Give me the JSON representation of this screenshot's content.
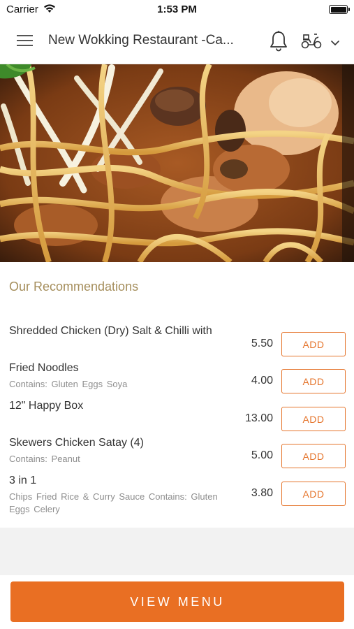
{
  "status_bar": {
    "carrier": "Carrier",
    "time": "1:53 PM"
  },
  "header": {
    "title": "New Wokking Restaurant -Ca...",
    "icons": [
      "menu-icon",
      "bell-icon",
      "scooter-icon",
      "chevron-down-icon"
    ]
  },
  "hero": {
    "image_description_icon": "food-photo"
  },
  "recommendations": {
    "title": "Our Recommendations",
    "items": [
      {
        "name": "Shredded Chicken (Dry) Salt & Chilli with",
        "sub": "",
        "price": "5.50",
        "button": "ADD"
      },
      {
        "name": "Fried Noodles",
        "sub": "Contains:  Gluten  Eggs  Soya",
        "price": "4.00",
        "button": "ADD"
      },
      {
        "name": "12\" Happy Box",
        "sub": "",
        "price": "13.00",
        "button": "ADD"
      },
      {
        "name": "Skewers Chicken Satay (4)",
        "sub": "Contains:  Peanut",
        "price": "5.00",
        "button": "ADD"
      },
      {
        "name": "3 in 1",
        "sub": "Chips Fried Rice & Curry Sauce   Contains:  Gluten  Eggs  Celery",
        "price": "3.80",
        "button": "ADD"
      }
    ]
  },
  "footer": {
    "view_menu_label": "VIEW MENU"
  },
  "colors": {
    "accent": "#e96f23",
    "section_title": "#a58e5c",
    "muted_text": "#8e8e8e"
  }
}
